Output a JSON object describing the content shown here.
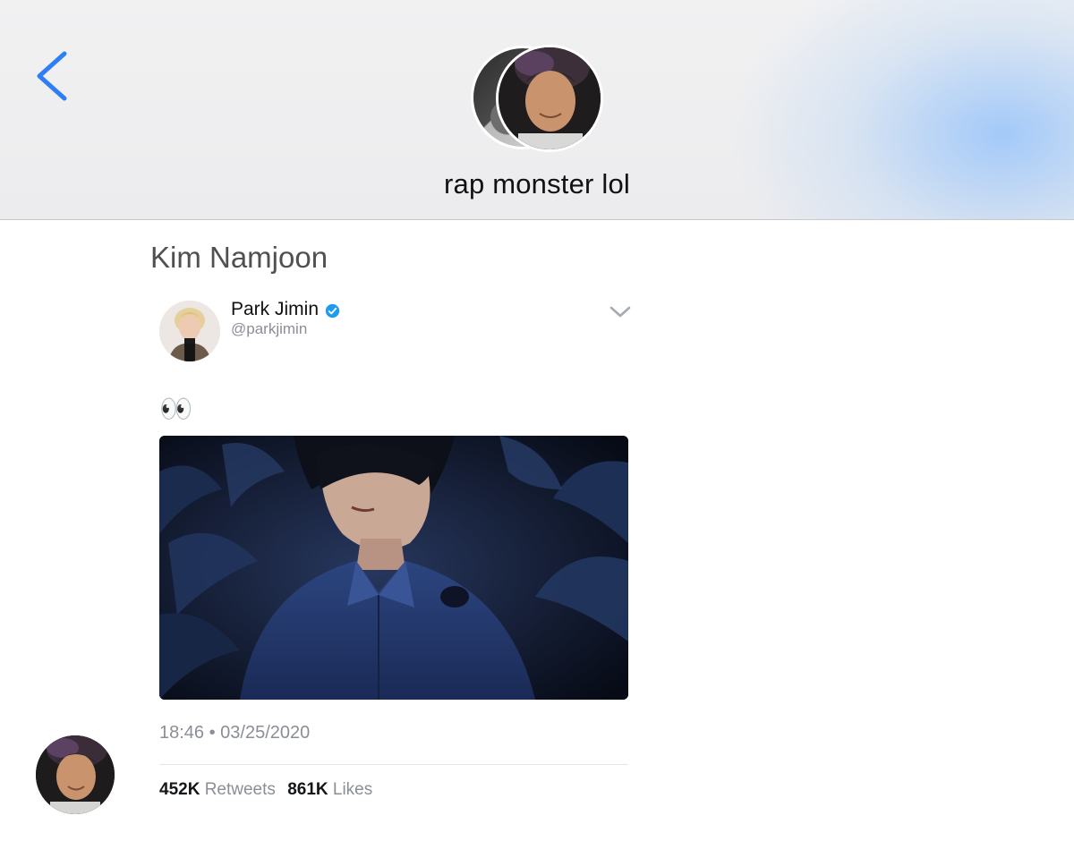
{
  "header": {
    "back_icon": "chevron-left-icon",
    "group_title": "rap monster lol",
    "accent_color": "#2f7ef5"
  },
  "message": {
    "sender_name": "Kim Namjoon",
    "tweet": {
      "author_name": "Park Jimin",
      "author_handle": "@parkjimin",
      "verified": true,
      "text": "👀",
      "timestamp": "18:46 • 03/25/2020",
      "retweets_count": "452K",
      "retweets_label": "Retweets",
      "likes_count": "861K",
      "likes_label": "Likes",
      "menu_icon": "chevron-down-icon",
      "verified_color": "#1d9bf0"
    }
  }
}
